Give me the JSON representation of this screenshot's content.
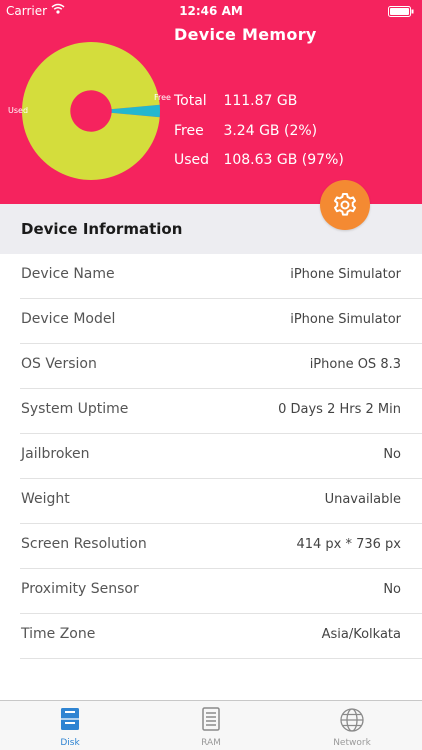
{
  "status_bar": {
    "carrier": "Carrier",
    "time": "12:46 AM"
  },
  "memory": {
    "title": "Device Memory",
    "total_label": "Total",
    "total_value": "111.87 GB",
    "free_label": "Free",
    "free_value": "3.24 GB (2%)",
    "used_label": "Used",
    "used_value": "108.63 GB (97%)"
  },
  "chart_data": {
    "type": "pie",
    "title": "",
    "labels": [
      "Used",
      "Free"
    ],
    "values": [
      108.63,
      3.24
    ],
    "colors": [
      "#d4dd3c",
      "#23b7cf"
    ],
    "hole_fraction": 0.3
  },
  "colors": {
    "header": "#f5235e",
    "accent": "#f48a32",
    "tab_active": "#2f84d2"
  },
  "section": {
    "title": "Device Information"
  },
  "info": [
    {
      "key": "Device Name",
      "value": "iPhone Simulator"
    },
    {
      "key": "Device Model",
      "value": "iPhone Simulator"
    },
    {
      "key": "OS Version",
      "value": "iPhone OS 8.3"
    },
    {
      "key": "System Uptime",
      "value": "0 Days 2 Hrs 2 Min"
    },
    {
      "key": "Jailbroken",
      "value": "No"
    },
    {
      "key": "Weight",
      "value": "Unavailable"
    },
    {
      "key": "Screen Resolution",
      "value": "414 px * 736 px"
    },
    {
      "key": "Proximity Sensor",
      "value": "No"
    },
    {
      "key": "Time Zone",
      "value": "Asia/Kolkata"
    }
  ],
  "tabs": [
    {
      "label": "Disk",
      "icon": "disk-icon",
      "active": true
    },
    {
      "label": "RAM",
      "icon": "ram-icon",
      "active": false
    },
    {
      "label": "Network",
      "icon": "globe-icon",
      "active": false
    }
  ]
}
